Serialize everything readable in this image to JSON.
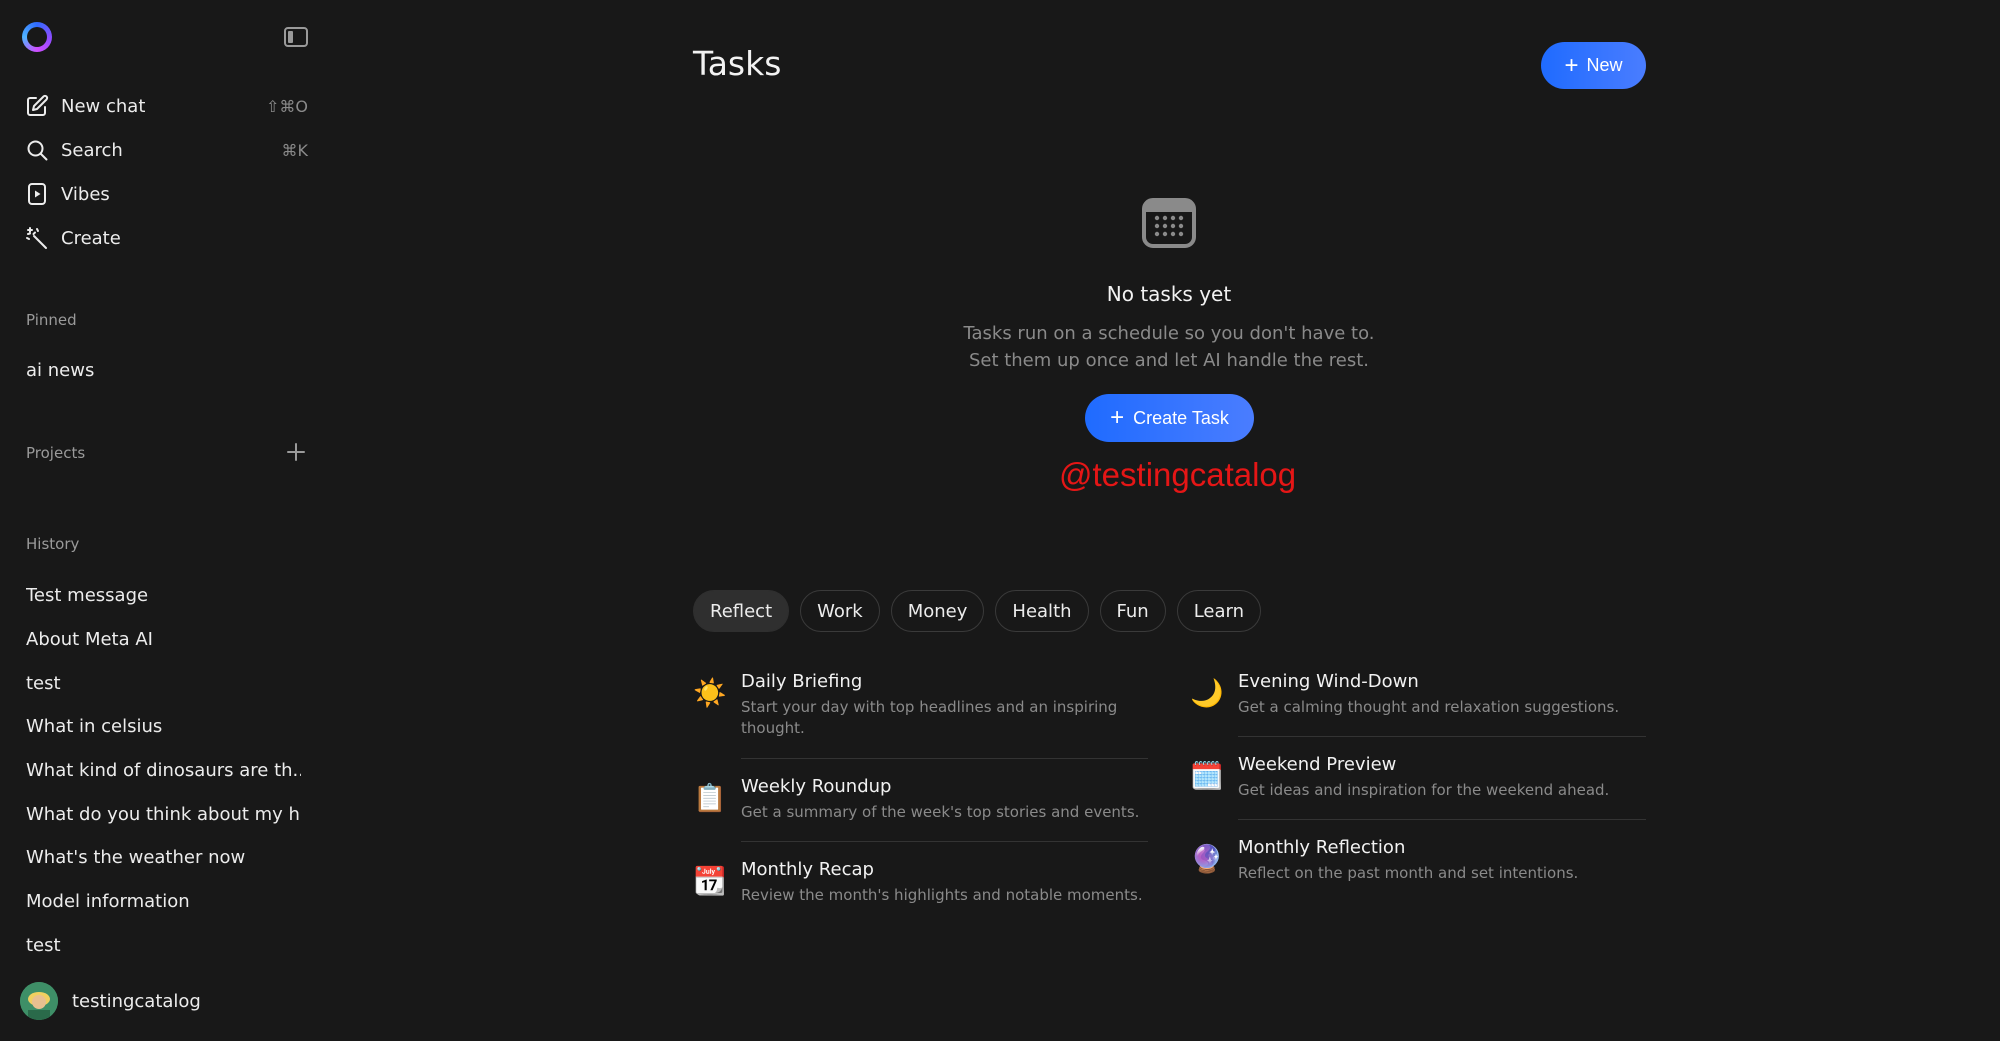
{
  "sidebar": {
    "nav": [
      {
        "label": "New chat",
        "shortcut": "⇧⌘O",
        "icon": "compose-icon"
      },
      {
        "label": "Search",
        "shortcut": "⌘K",
        "icon": "search-icon"
      },
      {
        "label": "Vibes",
        "shortcut": "",
        "icon": "play-icon"
      },
      {
        "label": "Create",
        "shortcut": "",
        "icon": "magic-wand-icon"
      }
    ],
    "pinned_label": "Pinned",
    "pinned": [
      "ai news"
    ],
    "projects_label": "Projects",
    "history_label": "History",
    "history": [
      "Test message",
      "About Meta AI",
      "test",
      "What in celsius",
      "What kind of dinosaurs are th...",
      "What do you think about my h...",
      "What's the weather now",
      "Model information",
      "test"
    ],
    "user_name": "testingcatalog"
  },
  "main": {
    "title": "Tasks",
    "new_button_label": "New",
    "empty_title": "No tasks yet",
    "empty_desc": "Tasks run on a schedule so you don't have to. Set them up once and let AI handle the rest.",
    "create_task_label": "Create Task",
    "watermark": "@testingcatalog",
    "filters": [
      "Reflect",
      "Work",
      "Money",
      "Health",
      "Fun",
      "Learn"
    ],
    "active_filter": "Reflect",
    "templates": [
      {
        "icon": "☀️",
        "title": "Daily Briefing",
        "desc": "Start your day with top headlines and an inspiring thought."
      },
      {
        "icon": "📋",
        "title": "Weekly Roundup",
        "desc": "Get a summary of the week's top stories and events."
      },
      {
        "icon": "📆",
        "title": "Monthly Recap",
        "desc": "Review the month's highlights and notable moments."
      },
      {
        "icon": "🌙",
        "title": "Evening Wind-Down",
        "desc": "Get a calming thought and relaxation suggestions."
      },
      {
        "icon": "🗓️",
        "title": "Weekend Preview",
        "desc": "Get ideas and inspiration for the weekend ahead."
      },
      {
        "icon": "🔮",
        "title": "Monthly Reflection",
        "desc": "Reflect on the past month and set intentions."
      }
    ]
  },
  "colors": {
    "background": "#181818",
    "accent": "#1f6bff",
    "watermark": "#e51616"
  }
}
